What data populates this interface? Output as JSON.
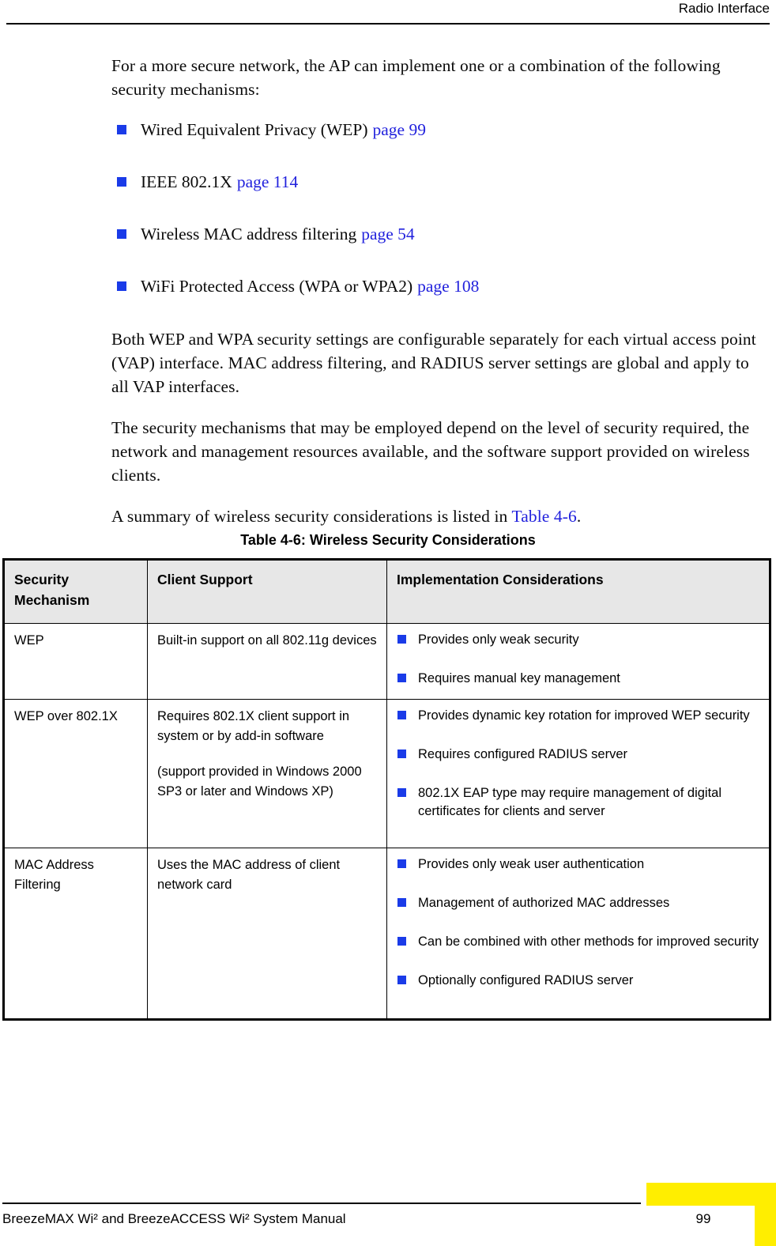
{
  "header": {
    "title": "Radio Interface"
  },
  "body": {
    "intro_paragraph": "For a more secure network, the AP can implement one or a combination of the following security mechanisms:",
    "mechanisms": [
      {
        "label": "Wired Equivalent Privacy (WEP)",
        "xref": "page 99"
      },
      {
        "label": "IEEE 802.1X",
        "xref": "page 114"
      },
      {
        "label": "Wireless MAC address filtering",
        "xref": "page 54"
      },
      {
        "label": "WiFi Protected Access (WPA or WPA2)",
        "xref": "page 108"
      }
    ],
    "paragraph_2": "Both WEP and WPA security settings are configurable separately for each virtual access point (VAP) interface. MAC address filtering, and RADIUS server settings are global and apply to all VAP interfaces.",
    "paragraph_3": "The security mechanisms that may be employed depend on the level of security required, the network and management resources available, and the software support provided on wireless clients.",
    "paragraph_4_prefix": "A summary of wireless security considerations is listed in ",
    "paragraph_4_xref": "Table 4-6",
    "paragraph_4_suffix": "."
  },
  "table": {
    "caption": "Table 4-6: Wireless Security Considerations",
    "headers": [
      "Security Mechanism",
      "Client Support",
      "Implementation Considerations"
    ],
    "rows": [
      {
        "mechanism": "WEP",
        "client_support": [
          "Built-in support on all 802.11g devices"
        ],
        "considerations": [
          "Provides only weak security",
          "Requires manual key management"
        ]
      },
      {
        "mechanism": "WEP over 802.1X",
        "client_support": [
          "Requires 802.1X client support in system or by add-in software",
          "(support provided in Windows 2000 SP3 or later and Windows XP)"
        ],
        "considerations": [
          "Provides dynamic key rotation for improved WEP security",
          "Requires configured RADIUS server",
          "802.1X EAP type may require management of digital certificates for clients and server"
        ]
      },
      {
        "mechanism": "MAC Address Filtering",
        "client_support": [
          "Uses the MAC address of client network card"
        ],
        "considerations": [
          "Provides only weak user authentication",
          "Management of authorized MAC addresses",
          "Can be combined with other methods for improved security",
          "Optionally configured RADIUS server"
        ]
      }
    ]
  },
  "footer": {
    "manual_title": "BreezeMAX Wi² and BreezeACCESS Wi² System Manual",
    "page_number": "99"
  },
  "colors": {
    "bullet": "#1a3be8",
    "xref_link": "#2222dd",
    "table_header_bg": "#e7e7e7",
    "accent_yellow": "#ffee00"
  }
}
